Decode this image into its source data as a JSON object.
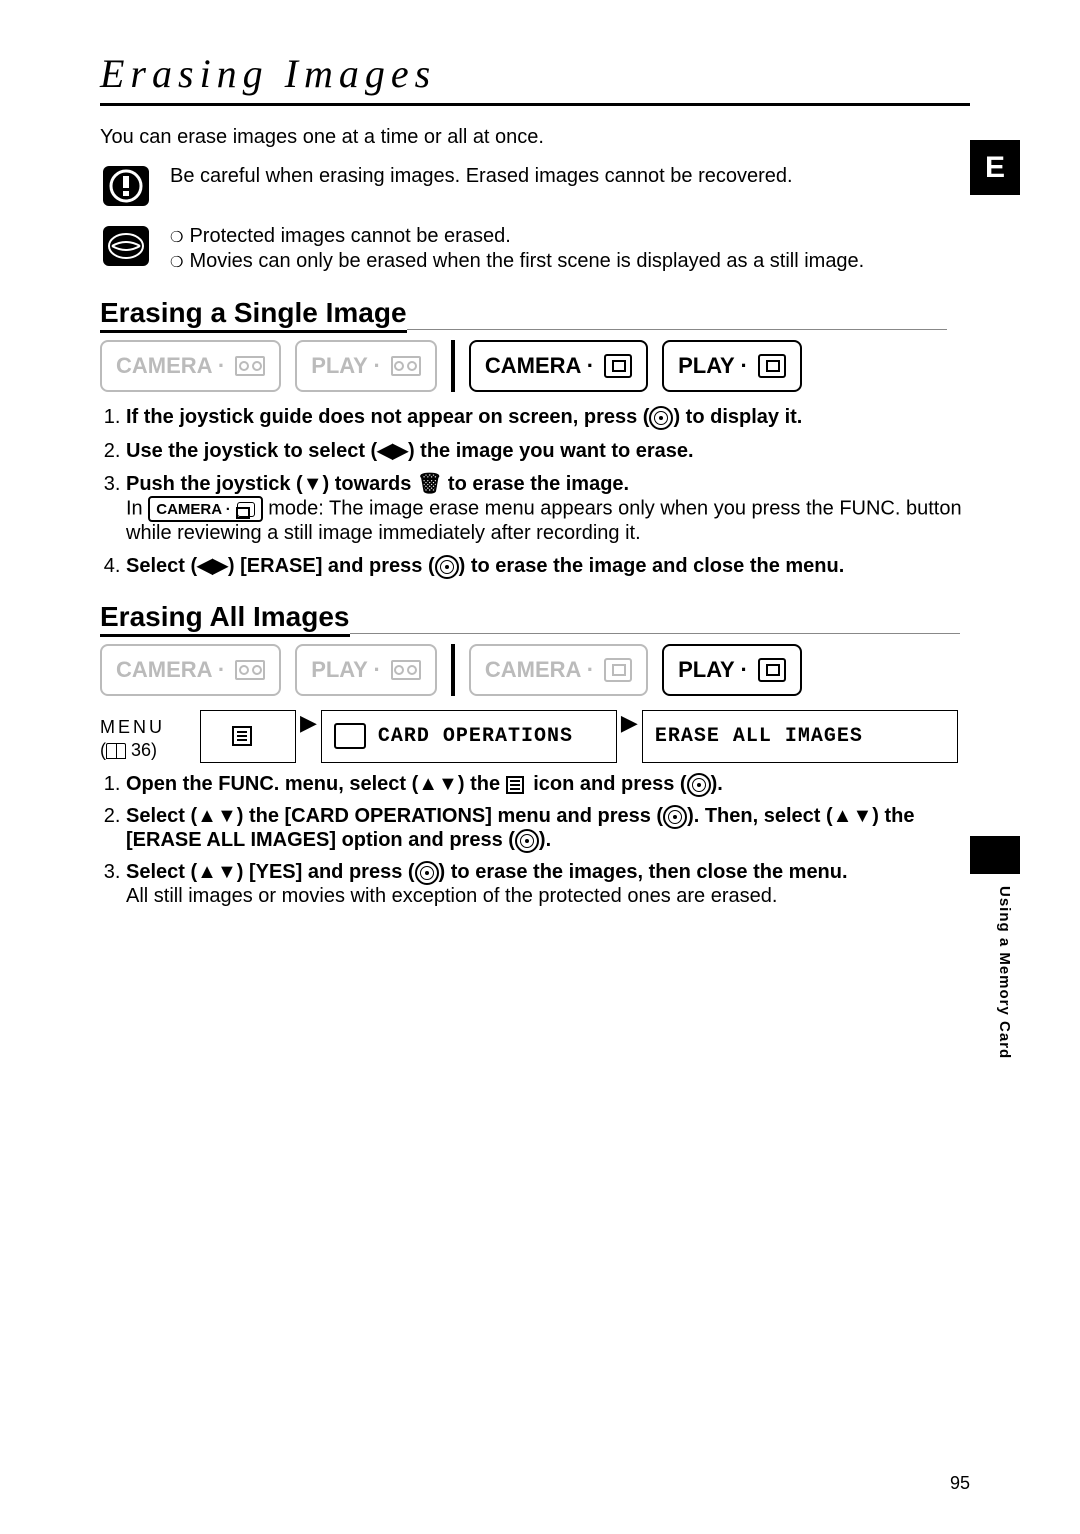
{
  "page": {
    "title": "Erasing Images",
    "intro": "You can erase images one at a time or all at once.",
    "warning": "Be careful when erasing images. Erased images cannot be recovered.",
    "notes": [
      "Protected images cannot be erased.",
      "Movies can only be erased when the first scene is displayed as a still image."
    ],
    "page_number": "95"
  },
  "side": {
    "lang": "E",
    "section": "Using a Memory Card"
  },
  "section1": {
    "heading": "Erasing a Single Image",
    "modes": {
      "camera_tape": "CAMERA ·",
      "play_tape": "PLAY ·",
      "camera_card": "CAMERA ·",
      "play_card": "PLAY ·"
    },
    "steps": {
      "s1": "If the joystick guide does not appear on screen, press (",
      "s1b": ") to display it.",
      "s2": "Use the joystick to select (◀▶) the image you want to erase.",
      "s3": "Push the joystick (▼) towards",
      "s3b": "to erase the image.",
      "s3_sub_a": "In",
      "s3_sub_cam": "CAMERA ·",
      "s3_sub_b": "mode: The image erase menu appears only when you press the FUNC. button while reviewing a still image immediately after recording it.",
      "s4a": "Select (◀▶) [ERASE] and press (",
      "s4b": ") to erase the image and close the menu."
    }
  },
  "section2": {
    "heading": "Erasing All Images",
    "modes": {
      "camera_tape": "CAMERA ·",
      "play_tape": "PLAY ·",
      "camera_card": "CAMERA ·",
      "play_card": "PLAY ·"
    },
    "menu": {
      "label": "MENU",
      "ref": "36",
      "item1": "CARD OPERATIONS",
      "item2": "ERASE ALL IMAGES"
    },
    "steps": {
      "s1a": "Open the FUNC. menu, select (▲▼) the",
      "s1b": "icon and press (",
      "s1c": ").",
      "s2a": "Select (▲▼) the [CARD OPERATIONS] menu and press (",
      "s2b": "). Then, select (▲▼) the [ERASE ALL IMAGES] option and press (",
      "s2c": ").",
      "s3a": "Select (▲▼) [YES] and press (",
      "s3b": ") to erase the images, then close the menu.",
      "s3_sub": "All still images or movies with exception of the protected ones are erased."
    }
  }
}
